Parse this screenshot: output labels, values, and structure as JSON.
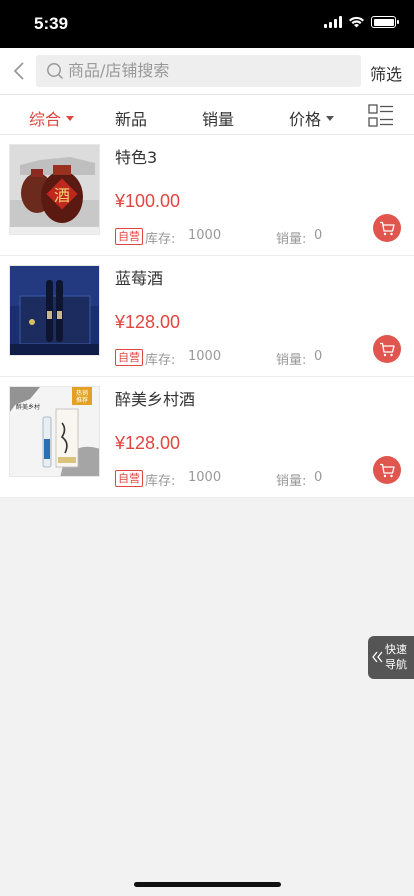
{
  "status_bar": {
    "time": "5:39"
  },
  "header": {
    "search_placeholder": "商品/店铺搜索",
    "filter_label": "筛选"
  },
  "sort_tabs": [
    {
      "label": "综合",
      "active": true
    },
    {
      "label": "新品",
      "active": false
    },
    {
      "label": "销量",
      "active": false
    },
    {
      "label": "价格",
      "active": false
    }
  ],
  "products": [
    {
      "name": "特色3",
      "price": "¥100.00",
      "badge": "自营",
      "stock_label": "库存:",
      "stock": "1000",
      "sales_label": "销量:",
      "sales": "0"
    },
    {
      "name": "蓝莓酒",
      "price": "¥128.00",
      "badge": "自营",
      "stock_label": "库存:",
      "stock": "1000",
      "sales_label": "销量:",
      "sales": "0"
    },
    {
      "name": "醉美乡村酒",
      "price": "¥128.00",
      "badge": "自营",
      "stock_label": "库存:",
      "stock": "1000",
      "sales_label": "销量:",
      "sales": "0"
    }
  ],
  "product_images": {
    "p1_char": "酒",
    "p3_tag_line1": "热销",
    "p3_tag_line2": "推荐",
    "p3_caption": "醉美乡村"
  },
  "quick_nav": {
    "label": "快速导航"
  },
  "colors": {
    "accent": "#e0463f",
    "cart": "#e0554e"
  }
}
